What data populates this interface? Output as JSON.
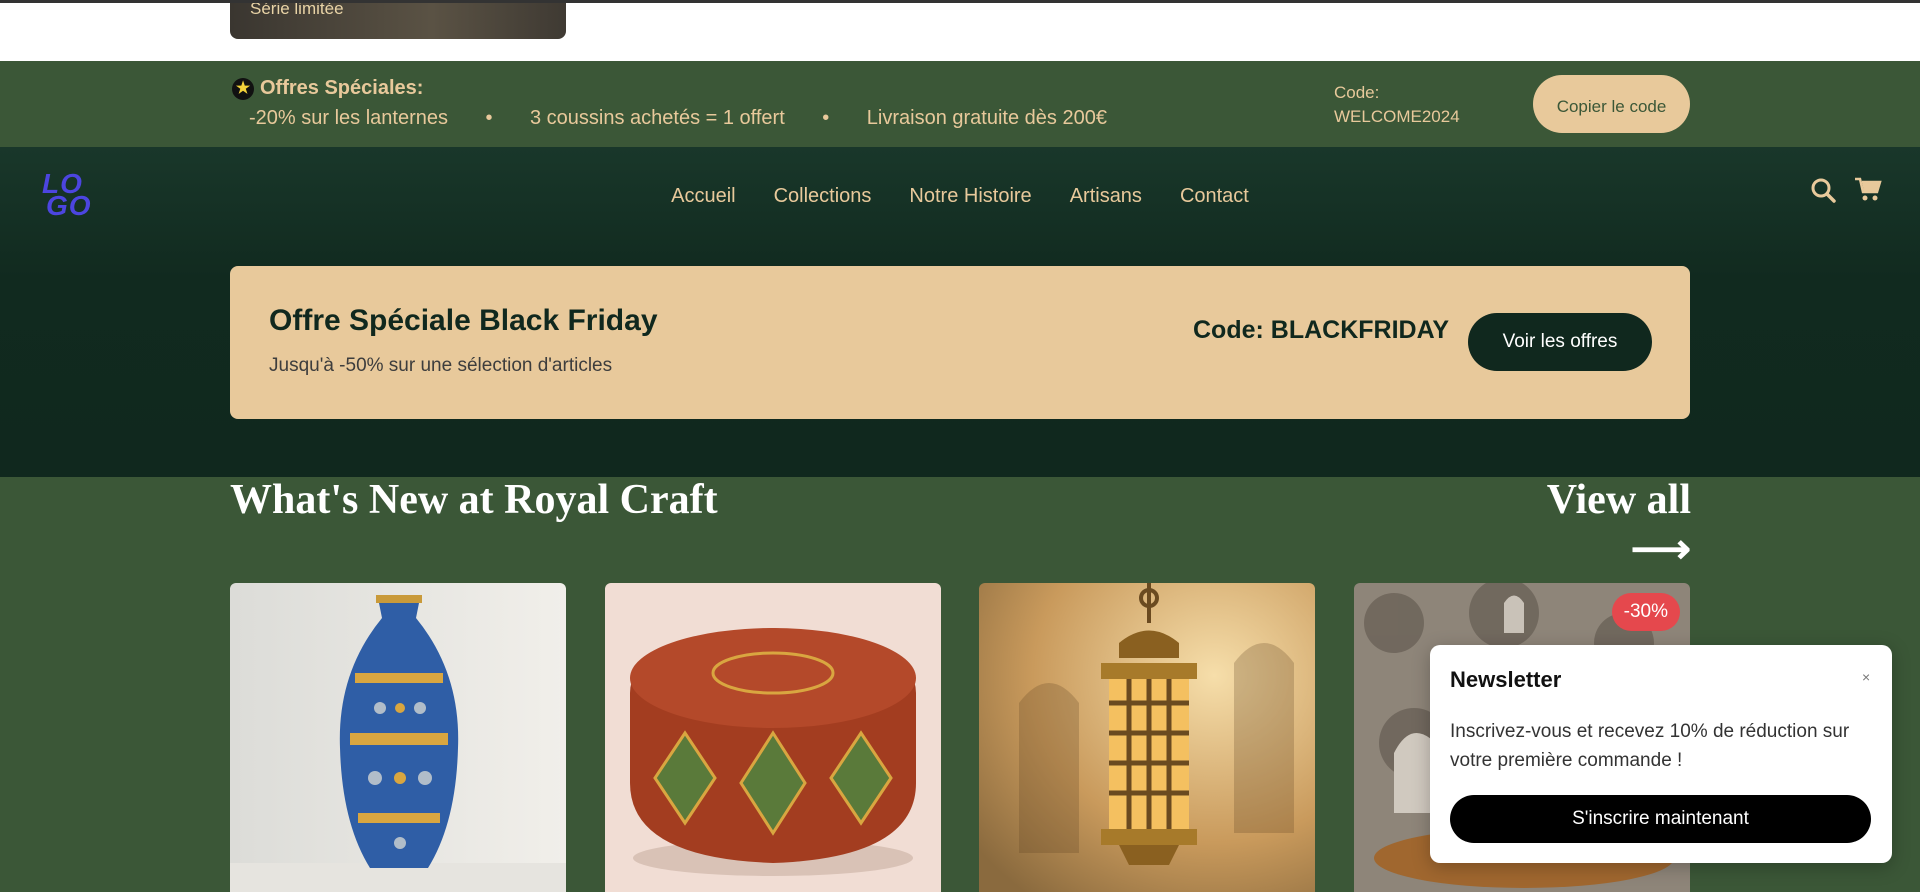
{
  "top_card": {
    "caption": "Série limitée"
  },
  "promo_bar": {
    "title": "Offres Spéciales:",
    "items": [
      "-20% sur les lanternes",
      "3 coussins achetés = 1 offert",
      "Livraison gratuite dès 200€"
    ],
    "separator": "•",
    "code_label": "Code: WELCOME2024",
    "copy_button": "Copier le code"
  },
  "header": {
    "logo_line1": "LO",
    "logo_line2": "GO",
    "nav": [
      "Accueil",
      "Collections",
      "Notre Histoire",
      "Artisans",
      "Contact"
    ],
    "icons": [
      "search-icon",
      "cart-icon"
    ]
  },
  "black_friday": {
    "title": "Offre Spéciale Black Friday",
    "subtitle": "Jusqu'à -50% sur une sélection d'articles",
    "code": "Code: BLACKFRIDAY",
    "button": "Voir les offres"
  },
  "new_section": {
    "title": "What's New at Royal Craft",
    "view_all": "View all ⟶",
    "products": [
      {
        "image": "blue-ceramic-vase"
      },
      {
        "image": "leather-pouf"
      },
      {
        "image": "brass-lantern"
      },
      {
        "image": "tea-set",
        "badge": "-30%"
      }
    ]
  },
  "newsletter": {
    "title": "Newsletter",
    "close": "×",
    "text": "Inscrivez-vous et recevez 10% de réduction sur votre première commande !",
    "button": "S'inscrire maintenant"
  },
  "colors": {
    "dark_green": "#10281e",
    "green": "#3b5737",
    "sand": "#e8c99b",
    "logo": "#4c45e0",
    "badge": "#e5484d"
  }
}
